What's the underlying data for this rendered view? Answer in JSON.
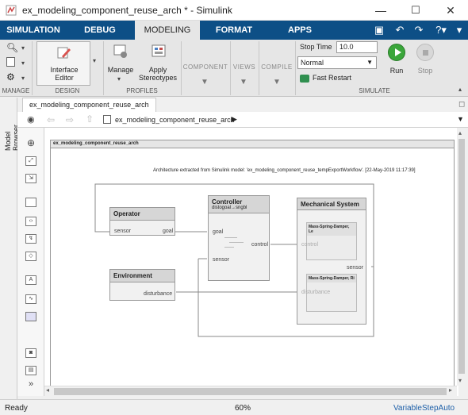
{
  "window": {
    "title": "ex_modeling_component_reuse_arch * - Simulink",
    "minimize": "—",
    "maximize": "☐",
    "close": "✕"
  },
  "tabs": [
    "SIMULATION",
    "DEBUG",
    "MODELING",
    "FORMAT",
    "APPS"
  ],
  "ribbon": {
    "interface_editor_label_1": "Interface",
    "interface_editor_label_2": "Editor",
    "manage_label": "Manage",
    "apply_stereotypes_1": "Apply",
    "apply_stereotypes_2": "Stereotypes",
    "component_label": "COMPONENT",
    "views_label": "VIEWS",
    "compile_label": "COMPILE",
    "stop_time_label": "Stop Time",
    "stop_time_value": "10.0",
    "mode_value": "Normal",
    "fast_restart": "Fast Restart",
    "run_label": "Run",
    "stop_label": "Stop",
    "groups": {
      "manage": "MANAGE",
      "design": "DESIGN",
      "profiles": "PROFILES",
      "simulate": "SIMULATE"
    }
  },
  "model_tab": "ex_modeling_component_reuse_arch",
  "model_browser": "Model Browser",
  "breadcrumb": "ex_modeling_component_reuse_arch",
  "diagram": {
    "frame_title": "ex_modeling_component_reuse_arch",
    "annotation": "Architecture extracted from Simulink model: 'ex_modeling_component_reuse_tempExportWorkflow'. [22-May-2019 11:17:39]",
    "operator": {
      "title": "Operator",
      "in_port": "sensor",
      "out_port": "goal"
    },
    "environment": {
      "title": "Environment",
      "out_port": "disturbance"
    },
    "controller": {
      "title": "Controller",
      "subtitle": "distogoal→sngbl",
      "in1": "goal",
      "in2": "sensor",
      "out": "control"
    },
    "mechanical": {
      "title": "Mechanical System",
      "sub1": "Mass-Spring-Damper, Le",
      "sub2": "Mass-Spring-Damper, Ri",
      "in1": "control",
      "in2": "disturbance",
      "out": "sensor"
    }
  },
  "status": {
    "left": "Ready",
    "zoom": "60%",
    "solver": "VariableStepAuto"
  }
}
